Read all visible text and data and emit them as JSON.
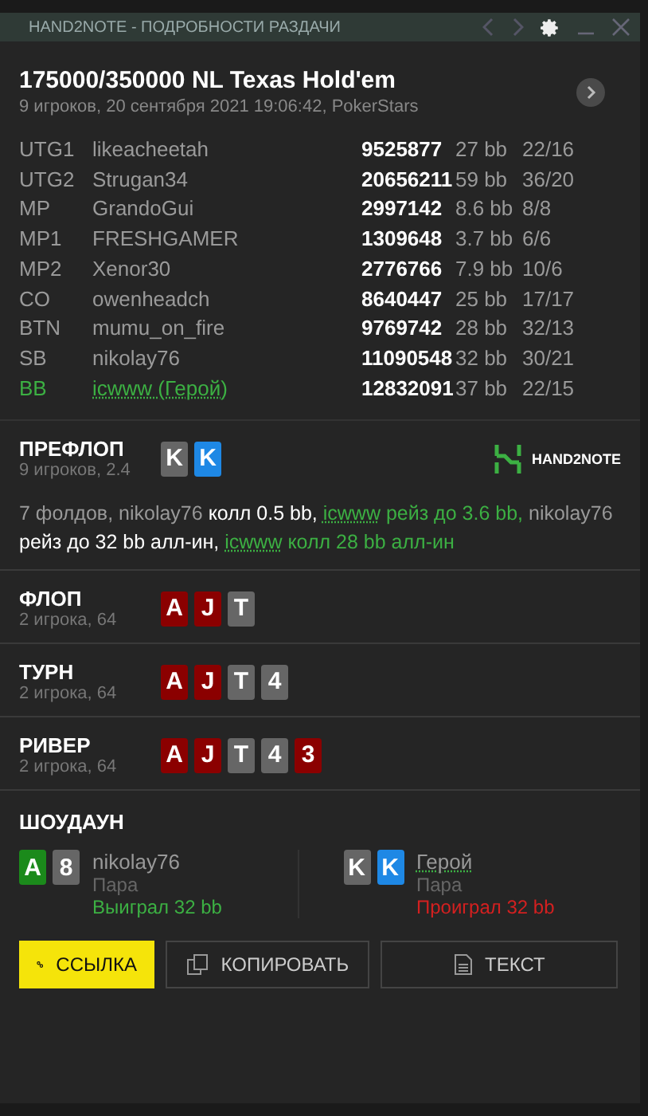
{
  "window": {
    "title": "HAND2NOTE - ПОДРОБНОСТИ РАЗДАЧИ"
  },
  "header": {
    "title": "175000/350000 NL Texas Hold'em",
    "subtitle": "9 игроков, 20 сентября 2021 19:06:42, PokerStars"
  },
  "players": [
    {
      "position": "UTG1",
      "name": "likeacheetah",
      "stack": "9525877",
      "bb": "27 bb",
      "stats": "22/16",
      "hero": false
    },
    {
      "position": "UTG2",
      "name": "Strugan34",
      "stack": "20656211",
      "bb": "59 bb",
      "stats": "36/20",
      "hero": false
    },
    {
      "position": "MP",
      "name": "GrandoGui",
      "stack": "2997142",
      "bb": "8.6 bb",
      "stats": "8/8",
      "hero": false
    },
    {
      "position": "MP1",
      "name": "FRESHGAMER",
      "stack": "1309648",
      "bb": "3.7 bb",
      "stats": "6/6",
      "hero": false
    },
    {
      "position": "MP2",
      "name": "Xenor30",
      "stack": "2776766",
      "bb": "7.9 bb",
      "stats": "10/6",
      "hero": false
    },
    {
      "position": "CO",
      "name": "owenheadch",
      "stack": "8640447",
      "bb": "25 bb",
      "stats": "17/17",
      "hero": false
    },
    {
      "position": "BTN",
      "name": "mumu_on_fire",
      "stack": "9769742",
      "bb": "28 bb",
      "stats": "32/13",
      "hero": false
    },
    {
      "position": "SB",
      "name": "nikolay76",
      "stack": "11090548",
      "bb": "32 bb",
      "stats": "30/21",
      "hero": false
    },
    {
      "position": "BB",
      "name": "icwww (Герой)",
      "stack": "12832091",
      "bb": "37 bb",
      "stats": "22/15",
      "hero": true
    }
  ],
  "streets": [
    {
      "name": "ПРЕФЛОП",
      "info": "9 игроков, 2.4",
      "cards": [
        {
          "rank": "K",
          "color": "#666666"
        },
        {
          "rank": "K",
          "color": "#1e88e5"
        }
      ],
      "logo": "HAND2NOTE",
      "actions": [
        {
          "kind": "player",
          "text": "7 фолдов, nikolay76"
        },
        {
          "kind": "action",
          "text": "колл 0.5 bb,"
        },
        {
          "kind": "hero",
          "text": "icwww"
        },
        {
          "kind": "heroaction",
          "text": "рейз до 3.6 bb,"
        },
        {
          "kind": "player",
          "text": "nikolay76"
        },
        {
          "kind": "action",
          "text": "рейз до 32 bb алл-ин,"
        },
        {
          "kind": "hero",
          "text": "icwww"
        },
        {
          "kind": "heroaction",
          "text": "колл 28 bb алл-ин"
        }
      ]
    },
    {
      "name": "ФЛОП",
      "info": "2 игрока, 64",
      "cards": [
        {
          "rank": "A",
          "color": "#8b0000"
        },
        {
          "rank": "J",
          "color": "#8b0000"
        },
        {
          "rank": "T",
          "color": "#666666"
        }
      ]
    },
    {
      "name": "ТУРН",
      "info": "2 игрока, 64",
      "cards": [
        {
          "rank": "A",
          "color": "#8b0000"
        },
        {
          "rank": "J",
          "color": "#8b0000"
        },
        {
          "rank": "T",
          "color": "#666666"
        },
        {
          "rank": "4",
          "color": "#666666"
        }
      ]
    },
    {
      "name": "РИВЕР",
      "info": "2 игрока, 64",
      "cards": [
        {
          "rank": "A",
          "color": "#8b0000"
        },
        {
          "rank": "J",
          "color": "#8b0000"
        },
        {
          "rank": "T",
          "color": "#666666"
        },
        {
          "rank": "4",
          "color": "#666666"
        },
        {
          "rank": "3",
          "color": "#8b0000"
        }
      ]
    }
  ],
  "showdown": {
    "title": "ШОУДАУН",
    "hands": [
      {
        "cards": [
          {
            "rank": "A",
            "color": "#1b8a1b"
          },
          {
            "rank": "8",
            "color": "#666666"
          }
        ],
        "name": "nikolay76",
        "hero": false,
        "combo": "Пара",
        "result": "Выиграл 32 bb",
        "won": true
      },
      {
        "cards": [
          {
            "rank": "K",
            "color": "#666666"
          },
          {
            "rank": "K",
            "color": "#1e88e5"
          }
        ],
        "name": "Герой",
        "hero": true,
        "combo": "Пара",
        "result": "Проиграл 32 bb",
        "won": false
      }
    ]
  },
  "buttons": [
    {
      "kind": "link",
      "label": "ССЫЛКА",
      "selected": true
    },
    {
      "kind": "copy",
      "label": "КОПИРОВАТЬ",
      "selected": false
    },
    {
      "kind": "text",
      "label": "ТЕКСТ",
      "selected": false
    }
  ]
}
